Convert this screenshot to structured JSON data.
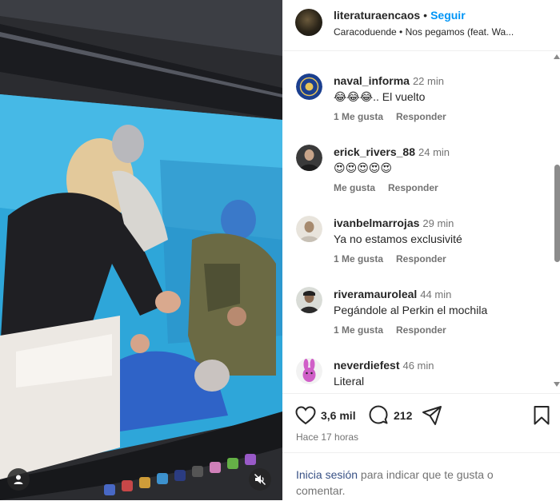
{
  "post": {
    "username": "literaturaencaos",
    "dot": "•",
    "follow_label": "Seguir",
    "audio": "Caracoduende • Nos pegamos (feat. Wa..."
  },
  "comments": [
    {
      "username": "naval_informa",
      "time": "22 min",
      "text": "😂😂😂.. El vuelto",
      "likes": "1 Me gusta",
      "reply": "Responder"
    },
    {
      "username": "erick_rivers_88",
      "time": "24 min",
      "text": "😍😍😍😍😍",
      "likes": "Me gusta",
      "reply": "Responder"
    },
    {
      "username": "ivanbelmarrojas",
      "time": "29 min",
      "text": "Ya no estamos exclusivité",
      "likes": "1 Me gusta",
      "reply": "Responder"
    },
    {
      "username": "riveramauroleal",
      "time": "44 min",
      "text": "Pegándole al Perkin el mochila",
      "likes": "1 Me gusta",
      "reply": "Responder"
    },
    {
      "username": "neverdiefest",
      "time": "46 min",
      "text": "Literal",
      "likes": "",
      "reply": ""
    }
  ],
  "actions": {
    "likes_count": "3,6 mil",
    "comments_count": "212",
    "like_icon": "heart-icon",
    "comment_icon": "comment-bubble-icon",
    "share_icon": "paper-plane-icon",
    "save_icon": "bookmark-icon"
  },
  "posted_ago": "Hace 17 horas",
  "login": {
    "link": "Inicia sesión",
    "rest": " para indicar que te gusta o comentar."
  },
  "colors": {
    "accent": "#0095f6",
    "text": "#262626",
    "muted": "#737373"
  }
}
